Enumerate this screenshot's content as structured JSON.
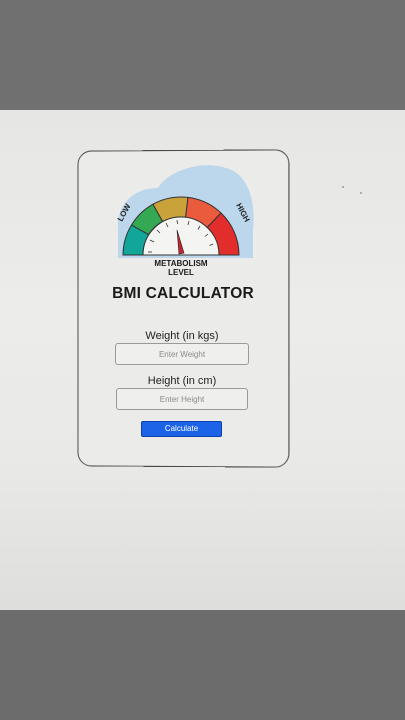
{
  "app": {
    "logo_top_left": "LOW",
    "logo_top_right": "HIGH",
    "logo_caption_line1": "METABOLISM",
    "logo_caption_line2": "LEVEL",
    "title": "BMI CALCULATOR"
  },
  "form": {
    "weight_label": "Weight (in kgs)",
    "weight_placeholder": "Enter Weight",
    "height_label": "Height (in cm)",
    "height_placeholder": "Enter Height",
    "calculate_label": "Calculate"
  },
  "colors": {
    "button": "#1d63e8",
    "gauge_teal": "#12a59a",
    "gauge_green": "#34a853",
    "gauge_gold": "#c9a33a",
    "gauge_orange": "#ea5a3c",
    "gauge_red": "#e32c2c",
    "gauge_blob": "#bcd7ec"
  }
}
